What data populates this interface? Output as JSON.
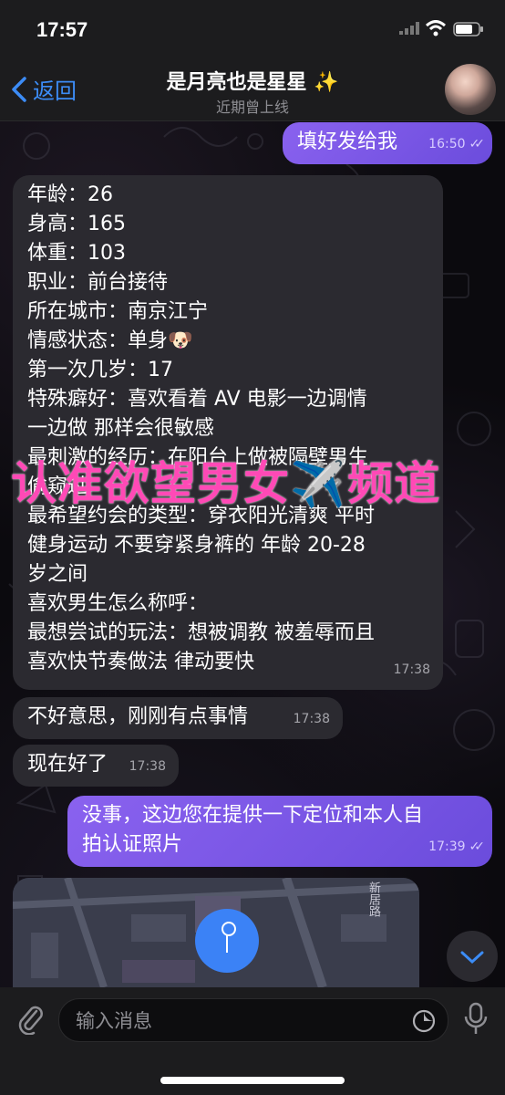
{
  "status_bar": {
    "time": "17:57"
  },
  "header": {
    "back_label": "返回",
    "title": "是月亮也是星星 ✨",
    "subtitle": "近期曾上线"
  },
  "messages": [
    {
      "dir": "out",
      "text": "填好发给我",
      "time": "16:50"
    },
    {
      "dir": "in",
      "lines": [
        "年龄：26",
        "身高：165",
        "体重：103",
        "职业：前台接待",
        "所在城市：南京江宁",
        "情感状态：单身🐶",
        "第一次几岁：17",
        "特殊癖好：喜欢看着 AV 电影一边调情",
        "一边做 那样会很敏感",
        "最刺激的经历：在阳台上做被隔壁男生",
        "偷窥过",
        "最希望约会的类型：穿衣阳光清爽 平时",
        "健身运动 不要穿紧身裤的 年龄 20-28",
        "岁之间",
        "喜欢男生怎么称呼：",
        "最想尝试的玩法：想被调教 被羞辱而且",
        "喜欢快节奏做法 律动要快"
      ],
      "time": "17:38"
    },
    {
      "dir": "in",
      "text": "不好意思，刚刚有点事情",
      "time": "17:38"
    },
    {
      "dir": "in",
      "text": "现在好了",
      "time": "17:38"
    },
    {
      "dir": "out",
      "lines": [
        "没事，这边您在提供一下定位和本人自",
        "拍认证照片"
      ],
      "time": "17:39"
    }
  ],
  "overlay": {
    "text": "认准欲望男女✈️频道"
  },
  "map": {
    "street_label": "新居路"
  },
  "input": {
    "placeholder": "输入消息"
  },
  "colors": {
    "accent": "#3c8cf6",
    "outgoing_bubble": "#7f59e8",
    "incoming_bubble": "#2b2a30",
    "overlay": "#ff49b6"
  }
}
